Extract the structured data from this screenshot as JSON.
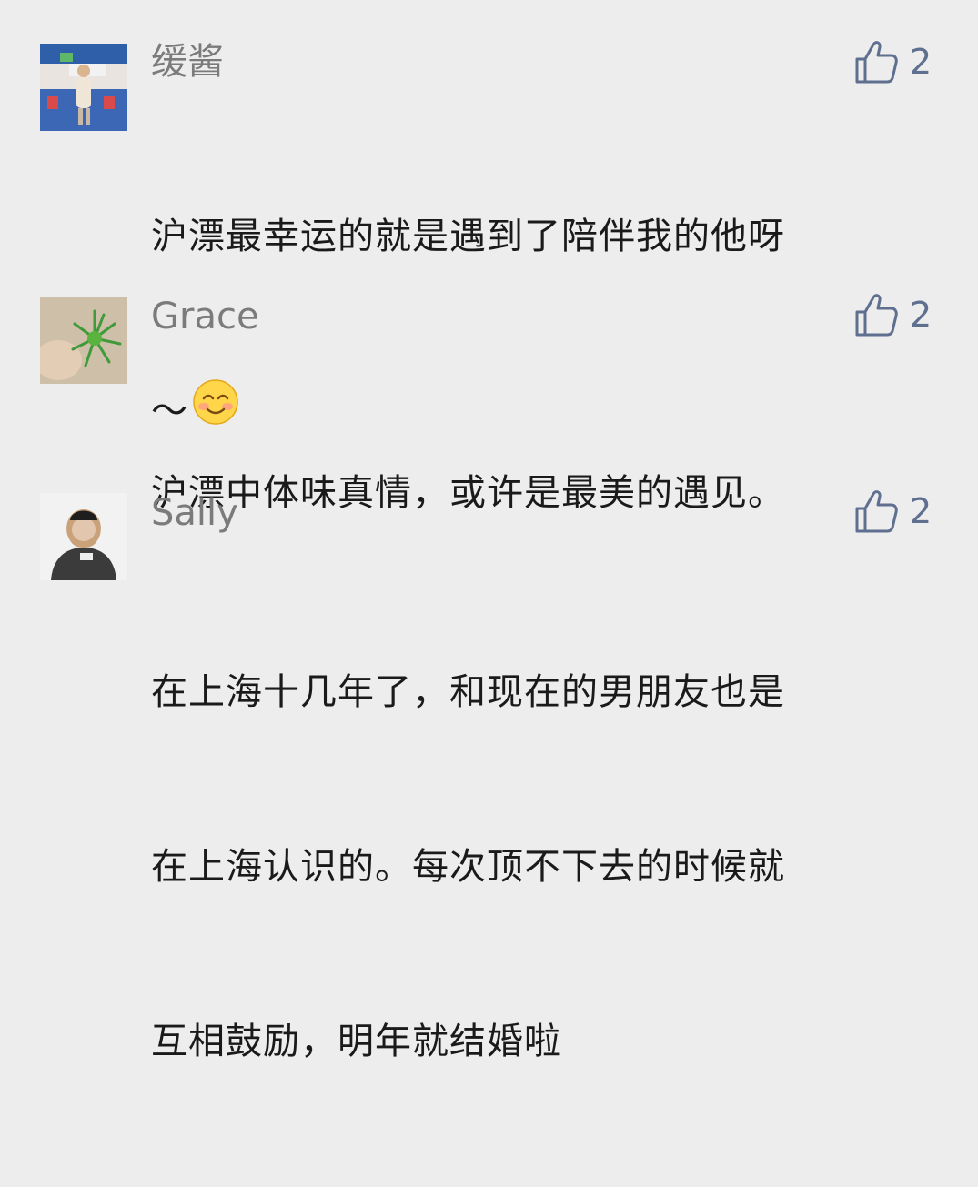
{
  "comments": [
    {
      "author": "缓酱",
      "likes": "2",
      "lines": [
        "沪漂最幸运的就是遇到了陪伴我的他呀",
        "～"
      ],
      "emoji": "smiling-face-icon"
    },
    {
      "author": "Grace",
      "likes": "2",
      "lines": [
        "沪漂中体味真情，或许是最美的遇见。"
      ]
    },
    {
      "author": "Sally",
      "likes": "2",
      "lines": [
        "在上海十几年了，和现在的男朋友也是",
        "在上海认识的。每次顶不下去的时候就",
        "互相鼓励，明年就结婚啦"
      ]
    }
  ],
  "colors": {
    "background": "#ededed",
    "name": "#7b7b7b",
    "like_icon": "#5f6f8f",
    "text": "#1a1a1a"
  }
}
